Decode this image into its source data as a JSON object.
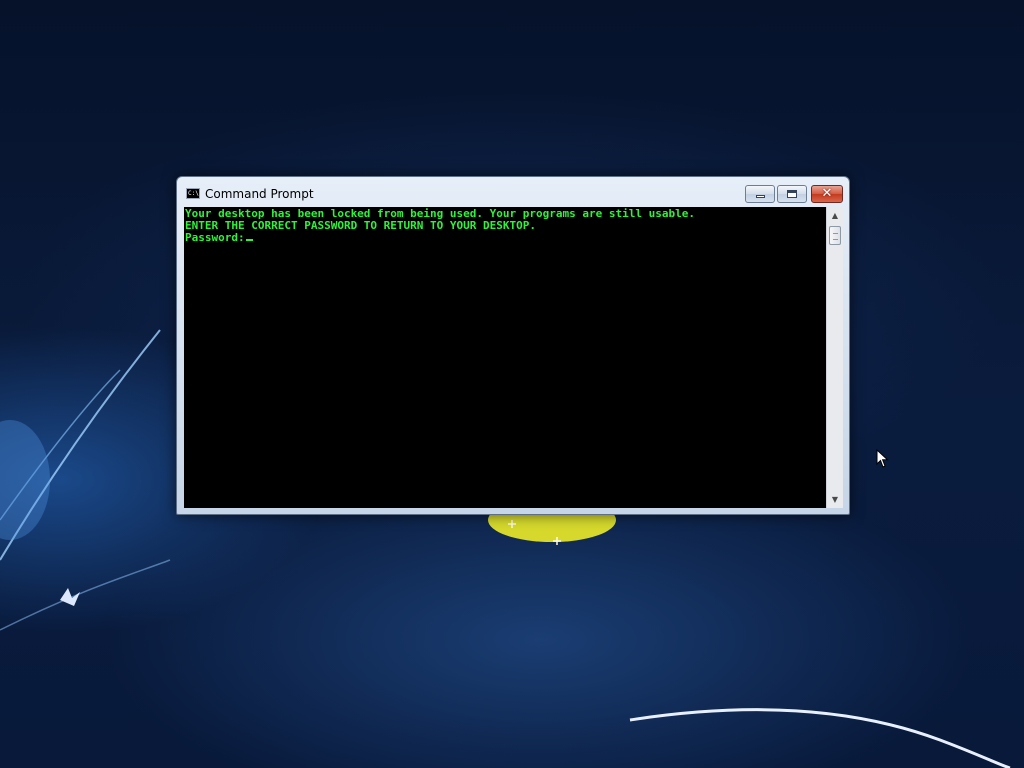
{
  "window": {
    "title": "Command Prompt",
    "icon": "cmd-icon",
    "icon_text": "C:\\",
    "buttons": {
      "minimize": "minimize-icon",
      "maximize": "maximize-icon",
      "close": "close-icon",
      "close_glyph": "✕"
    }
  },
  "console": {
    "lines": [
      "Your desktop has been locked from being used. Your programs are still usable.",
      "ENTER THE CORRECT PASSWORD TO RETURN TO YOUR DESKTOP.",
      "Password:"
    ],
    "input_value": "",
    "text_color": "#2ff23a",
    "background_color": "#000000"
  },
  "scrollbar": {
    "up_glyph": "▲",
    "down_glyph": "▼"
  },
  "desktop": {
    "wallpaper": "windows-7-blue-wallpaper"
  }
}
